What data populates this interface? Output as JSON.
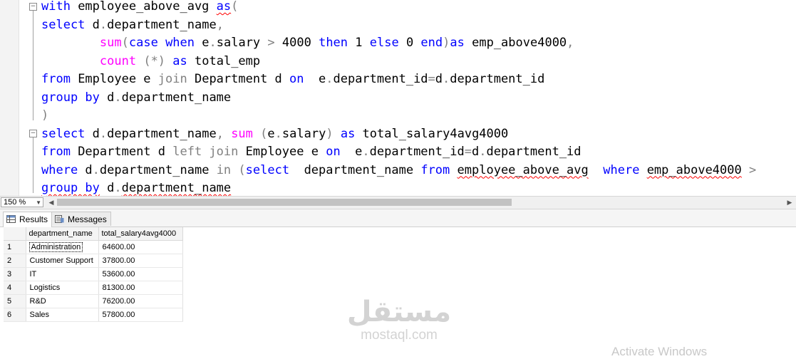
{
  "editor": {
    "lines": [
      [
        {
          "t": "with",
          "c": "kw"
        },
        {
          "t": " employee_above_avg "
        },
        {
          "t": "as",
          "c": "kw squig"
        },
        {
          "t": "(",
          "c": "gr"
        }
      ],
      [
        {
          "t": "select",
          "c": "kw"
        },
        {
          "t": " d"
        },
        {
          "t": ".",
          "c": "gr"
        },
        {
          "t": "department_name"
        },
        {
          "t": ",",
          "c": "gr"
        }
      ],
      [
        {
          "t": "        "
        },
        {
          "t": "sum",
          "c": "fn"
        },
        {
          "t": "(",
          "c": "gr"
        },
        {
          "t": "case",
          "c": "kw"
        },
        {
          "t": " "
        },
        {
          "t": "when",
          "c": "kw"
        },
        {
          "t": " e"
        },
        {
          "t": ".",
          "c": "gr"
        },
        {
          "t": "salary "
        },
        {
          "t": ">",
          "c": "gr"
        },
        {
          "t": " 4000 "
        },
        {
          "t": "then",
          "c": "kw"
        },
        {
          "t": " 1 "
        },
        {
          "t": "else",
          "c": "kw"
        },
        {
          "t": " 0 "
        },
        {
          "t": "end",
          "c": "kw"
        },
        {
          "t": ")",
          "c": "gr"
        },
        {
          "t": "as",
          "c": "kw"
        },
        {
          "t": " emp_above4000"
        },
        {
          "t": ",",
          "c": "gr"
        }
      ],
      [
        {
          "t": "        "
        },
        {
          "t": "count",
          "c": "fn"
        },
        {
          "t": " "
        },
        {
          "t": "(*)",
          "c": "gr"
        },
        {
          "t": " "
        },
        {
          "t": "as",
          "c": "kw"
        },
        {
          "t": " total_emp"
        }
      ],
      [
        {
          "t": "from",
          "c": "kw"
        },
        {
          "t": " Employee e "
        },
        {
          "t": "join",
          "c": "gr"
        },
        {
          "t": " Department d "
        },
        {
          "t": "on",
          "c": "kw"
        },
        {
          "t": "  e"
        },
        {
          "t": ".",
          "c": "gr"
        },
        {
          "t": "department_id"
        },
        {
          "t": "=",
          "c": "gr"
        },
        {
          "t": "d"
        },
        {
          "t": ".",
          "c": "gr"
        },
        {
          "t": "department_id"
        }
      ],
      [
        {
          "t": "group by",
          "c": "kw"
        },
        {
          "t": " d"
        },
        {
          "t": ".",
          "c": "gr"
        },
        {
          "t": "department_name"
        }
      ],
      [
        {
          "t": ")",
          "c": "gr"
        }
      ],
      [
        {
          "t": "select",
          "c": "kw"
        },
        {
          "t": " d"
        },
        {
          "t": ".",
          "c": "gr"
        },
        {
          "t": "department_name"
        },
        {
          "t": ",",
          "c": "gr"
        },
        {
          "t": " "
        },
        {
          "t": "sum",
          "c": "fn"
        },
        {
          "t": " "
        },
        {
          "t": "(",
          "c": "gr"
        },
        {
          "t": "e"
        },
        {
          "t": ".",
          "c": "gr"
        },
        {
          "t": "salary"
        },
        {
          "t": ")",
          "c": "gr"
        },
        {
          "t": " "
        },
        {
          "t": "as",
          "c": "kw"
        },
        {
          "t": " total_salary4avg4000"
        }
      ],
      [
        {
          "t": "from",
          "c": "kw"
        },
        {
          "t": " Department d "
        },
        {
          "t": "left join",
          "c": "gr"
        },
        {
          "t": " Employee e "
        },
        {
          "t": "on",
          "c": "kw"
        },
        {
          "t": "  e"
        },
        {
          "t": ".",
          "c": "gr"
        },
        {
          "t": "department_id"
        },
        {
          "t": "=",
          "c": "gr"
        },
        {
          "t": "d"
        },
        {
          "t": ".",
          "c": "gr"
        },
        {
          "t": "department_id"
        }
      ],
      [
        {
          "t": "where",
          "c": "kw"
        },
        {
          "t": " d"
        },
        {
          "t": ".",
          "c": "gr"
        },
        {
          "t": "department_name "
        },
        {
          "t": "in",
          "c": "gr"
        },
        {
          "t": " "
        },
        {
          "t": "(",
          "c": "gr"
        },
        {
          "t": "select",
          "c": "kw"
        },
        {
          "t": "  department_name "
        },
        {
          "t": "from",
          "c": "kw"
        },
        {
          "t": " "
        },
        {
          "t": "employee_above_avg",
          "c": "squig"
        },
        {
          "t": "  "
        },
        {
          "t": "where",
          "c": "kw"
        },
        {
          "t": " "
        },
        {
          "t": "emp_above4000",
          "c": "squig"
        },
        {
          "t": " "
        },
        {
          "t": ">",
          "c": "gr"
        }
      ],
      [
        {
          "t": "group by",
          "c": "kw squig"
        },
        {
          "t": " d"
        },
        {
          "t": ".",
          "c": "gr"
        },
        {
          "t": "department_name",
          "c": "squig"
        }
      ]
    ]
  },
  "zoom": {
    "value": "150 %"
  },
  "tabs": {
    "results": "Results",
    "messages": "Messages"
  },
  "grid": {
    "columns": [
      "department_name",
      "total_salary4avg4000"
    ],
    "rows": [
      {
        "n": "1",
        "name": "Administration",
        "total": "64600.00"
      },
      {
        "n": "2",
        "name": "Customer Support",
        "total": "37800.00"
      },
      {
        "n": "3",
        "name": "IT",
        "total": "53600.00"
      },
      {
        "n": "4",
        "name": "Logistics",
        "total": "81300.00"
      },
      {
        "n": "5",
        "name": "R&D",
        "total": "76200.00"
      },
      {
        "n": "6",
        "name": "Sales",
        "total": "57800.00"
      }
    ]
  },
  "watermark": {
    "arabic": "مستقل",
    "latin": "mostaql.com"
  },
  "activate_text": "Activate Windows",
  "icons": {
    "fold": "minus-box-icon",
    "results": "grid-icon",
    "messages": "messages-icon",
    "scroll_left": "triangle-left-icon",
    "scroll_right": "triangle-right-icon",
    "zoom_dropdown": "chevron-down-icon"
  }
}
